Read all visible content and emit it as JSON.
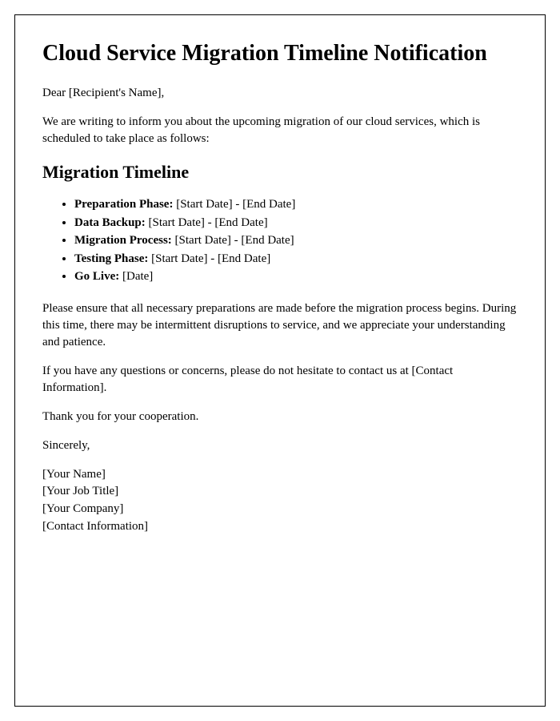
{
  "title": "Cloud Service Migration Timeline Notification",
  "greeting": "Dear [Recipient's Name],",
  "intro": "We are writing to inform you about the upcoming migration of our cloud services, which is scheduled to take place as follows:",
  "section_heading": "Migration Timeline",
  "timeline": [
    {
      "label": "Preparation Phase:",
      "value": "[Start Date] - [End Date]"
    },
    {
      "label": "Data Backup:",
      "value": "[Start Date] - [End Date]"
    },
    {
      "label": "Migration Process:",
      "value": "[Start Date] - [End Date]"
    },
    {
      "label": "Testing Phase:",
      "value": "[Start Date] - [End Date]"
    },
    {
      "label": "Go Live:",
      "value": "[Date]"
    }
  ],
  "body1": "Please ensure that all necessary preparations are made before the migration process begins. During this time, there may be intermittent disruptions to service, and we appreciate your understanding and patience.",
  "body2": "If you have any questions or concerns, please do not hesitate to contact us at [Contact Information].",
  "thanks": "Thank you for your cooperation.",
  "closing": "Sincerely,",
  "signature": {
    "name": "[Your Name]",
    "title": "[Your Job Title]",
    "company": "[Your Company]",
    "contact": "[Contact Information]"
  }
}
